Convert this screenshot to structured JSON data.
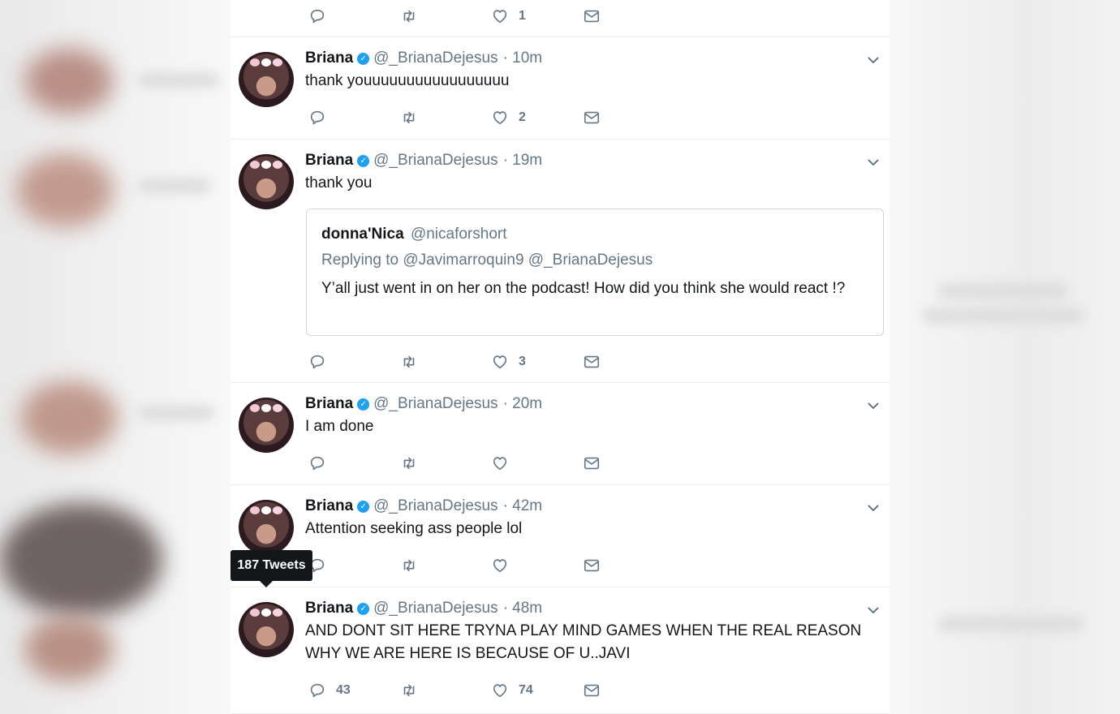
{
  "colors": {
    "accent": "#1da1f2",
    "muted": "#657786",
    "text": "#14171a",
    "border": "#e6ecf0"
  },
  "top_actions": {
    "likes": "1"
  },
  "tweets": [
    {
      "name": "Briana",
      "handle": "@_BrianaDejesus",
      "time": "· 10m",
      "text": "thank youuuuuuuuuuuuuuuuu",
      "replies": "",
      "retweets": "",
      "likes": "2"
    },
    {
      "name": "Briana",
      "handle": "@_BrianaDejesus",
      "time": "· 19m",
      "text": "thank you",
      "replies": "",
      "retweets": "",
      "likes": "3",
      "quote": {
        "name": "donna'Nica",
        "handle": "@nicaforshort",
        "replying": "Replying to @Javimarroquin9 @_BrianaDejesus",
        "text": "Y’all just went in on her on the podcast! How did you think she would react !?"
      }
    },
    {
      "name": "Briana",
      "handle": "@_BrianaDejesus",
      "time": "· 20m",
      "text": "I am done",
      "replies": "",
      "retweets": "",
      "likes": ""
    },
    {
      "name": "Briana",
      "handle": "@_BrianaDejesus",
      "time": "· 42m",
      "text": "Attention seeking ass people lol",
      "replies": "",
      "retweets": "",
      "likes": ""
    },
    {
      "name": "Briana",
      "handle": "@_BrianaDejesus",
      "time": "· 48m",
      "text": "AND DONT SIT HERE TRYNA PLAY MIND GAMES WHEN THE REAL REASON WHY WE ARE HERE IS BECAUSE OF U..JAVI",
      "replies": "43",
      "retweets": "",
      "likes": "74"
    }
  ],
  "tooltip": {
    "label": "187 Tweets"
  },
  "icons": {
    "reply": "reply-icon",
    "retweet": "retweet-icon",
    "like": "heart-icon",
    "dm": "envelope-icon",
    "verified": "verified-badge-icon",
    "caret": "chevron-down-icon"
  }
}
